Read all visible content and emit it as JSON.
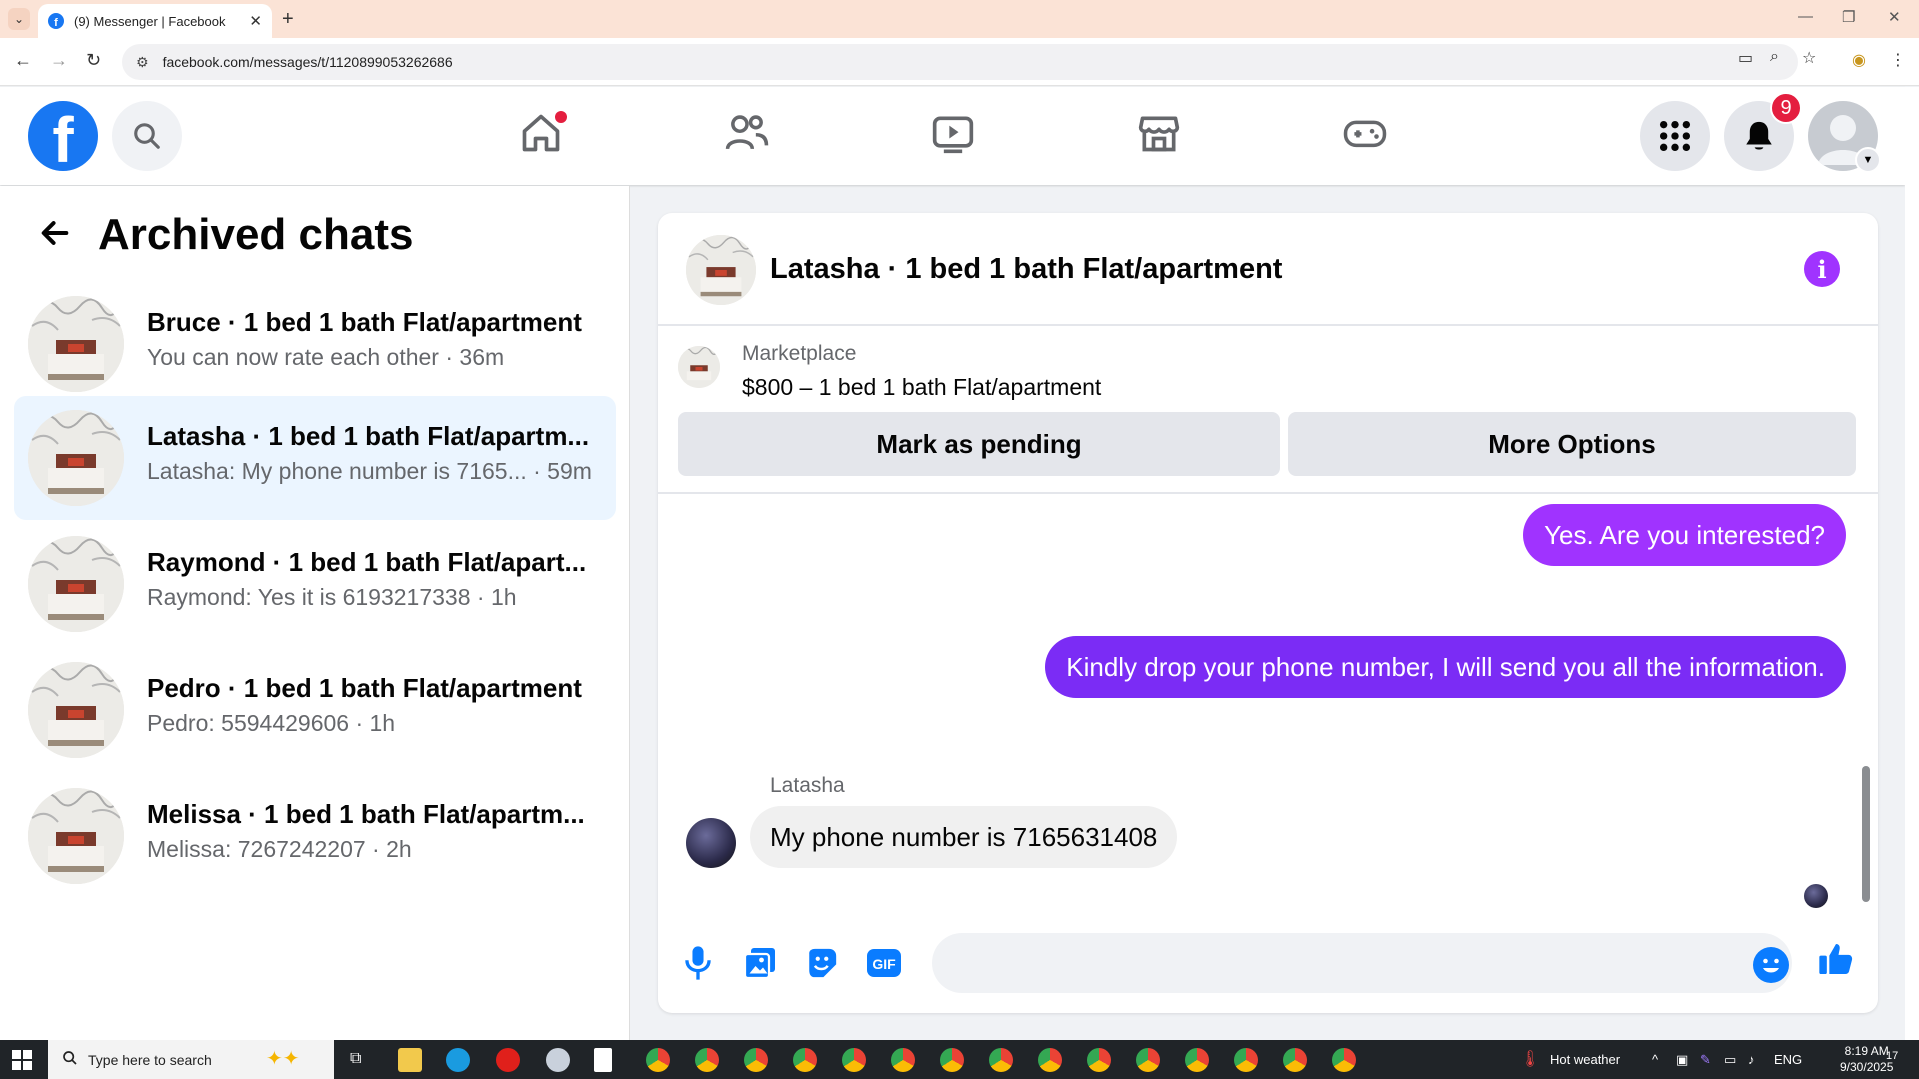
{
  "browser": {
    "tab_title": "(9) Messenger | Facebook",
    "url": "facebook.com/messages/t/1120899053262686",
    "new_tab_label": "+"
  },
  "fb": {
    "notification_count": "9"
  },
  "left_panel": {
    "title": "Archived chats",
    "chats": [
      {
        "name": "Bruce · 1 bed 1 bath Flat/apartment",
        "preview": "You can now rate each other · 36m",
        "active": false
      },
      {
        "name": "Latasha · 1 bed 1 bath Flat/apartm...",
        "preview": "Latasha: My phone number is 7165...  · 59m",
        "active": true
      },
      {
        "name": "Raymond · 1 bed 1 bath Flat/apart...",
        "preview": "Raymond: Yes it is 6193217338 · 1h",
        "active": false
      },
      {
        "name": "Pedro · 1 bed 1 bath Flat/apartment",
        "preview": "Pedro: 5594429606 · 1h",
        "active": false
      },
      {
        "name": "Melissa · 1 bed 1 bath Flat/apartm...",
        "preview": "Melissa: 7267242207 · 2h",
        "active": false
      }
    ]
  },
  "conversation": {
    "title": "Latasha · 1 bed 1 bath Flat/apartment",
    "info_icon": "i",
    "marketplace_label": "Marketplace",
    "listing": "$800 – 1 bed 1 bath Flat/apartment",
    "mark_pending": "Mark as pending",
    "more_options": "More Options",
    "messages": [
      {
        "from": "me",
        "text": "Yes. Are you interested?"
      },
      {
        "from": "me",
        "text": "Kindly drop your phone number, I will send you all the information."
      },
      {
        "from": "Latasha",
        "sender_label": "Latasha",
        "text": "My phone number is 7165631408"
      }
    ]
  },
  "colors": {
    "fb_blue": "#1877f2",
    "bubble_purple": "#a033ff",
    "bubble_violet": "#7b2cf5",
    "active_chat_bg": "#ebf5ff",
    "badge_red": "#e41e3f"
  },
  "taskbar": {
    "search_placeholder": "Type here to search",
    "weather": "Hot weather",
    "lang": "ENG",
    "time": "8:19 AM",
    "date": "9/30/2025",
    "notif_count": "17"
  }
}
